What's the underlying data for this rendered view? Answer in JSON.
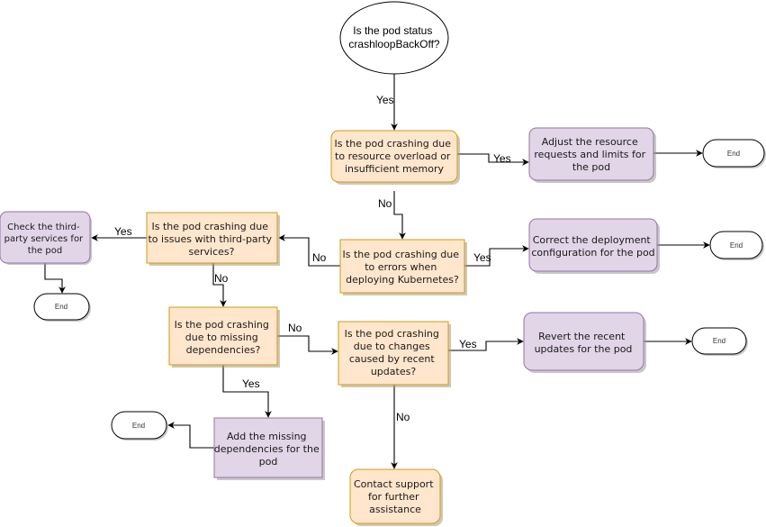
{
  "diagram": {
    "colors": {
      "decision_fill": "#ffe6cc",
      "decision_stroke": "#d79b00",
      "action_fill": "#e1d5e7",
      "action_stroke": "#9673a6",
      "edge": "#000000"
    },
    "start": {
      "lines": [
        "Is the pod status",
        "crashloopBackOff?"
      ]
    },
    "nodes": {
      "q_resource": {
        "lines": [
          "Is the pod crashing due",
          "to resource overload or",
          "insufficient memory"
        ]
      },
      "a_adjust": {
        "lines": [
          "Adjust the resource",
          "requests and limits for",
          "the pod"
        ]
      },
      "q_kubernetes": {
        "lines": [
          "Is the pod crashing due",
          "to errors when",
          "deploying Kubernetes?"
        ]
      },
      "a_correct": {
        "lines": [
          "Correct the deployment",
          "configuration for the pod"
        ]
      },
      "q_thirdparty": {
        "lines": [
          "Is the pod crashing due",
          "to issues with third-party",
          "services?"
        ]
      },
      "a_check": {
        "lines": [
          "Check the third-",
          "party services for",
          "the pod"
        ]
      },
      "q_dependencies": {
        "lines": [
          "Is the pod crashing",
          "due to missing",
          "dependencies?"
        ]
      },
      "a_add": {
        "lines": [
          "Add the missing",
          "dependencies for the",
          "pod"
        ]
      },
      "q_updates": {
        "lines": [
          "Is the pod crashing",
          "due to changes",
          "caused by recent",
          "updates?"
        ]
      },
      "a_revert": {
        "lines": [
          "Revert the recent",
          "updates for the pod"
        ]
      },
      "a_contact": {
        "lines": [
          "Contact support",
          "for further",
          "assistance"
        ]
      }
    },
    "end_label": "End",
    "edge_labels": {
      "start_to_resource": "Yes",
      "resource_yes": "Yes",
      "resource_no": "No",
      "kubernetes_yes": "Yes",
      "kubernetes_no": "No",
      "thirdparty_yes": "Yes",
      "thirdparty_no": "No",
      "dependencies_no": "No",
      "dependencies_yes": "Yes",
      "updates_yes": "Yes",
      "updates_no": "No"
    }
  }
}
